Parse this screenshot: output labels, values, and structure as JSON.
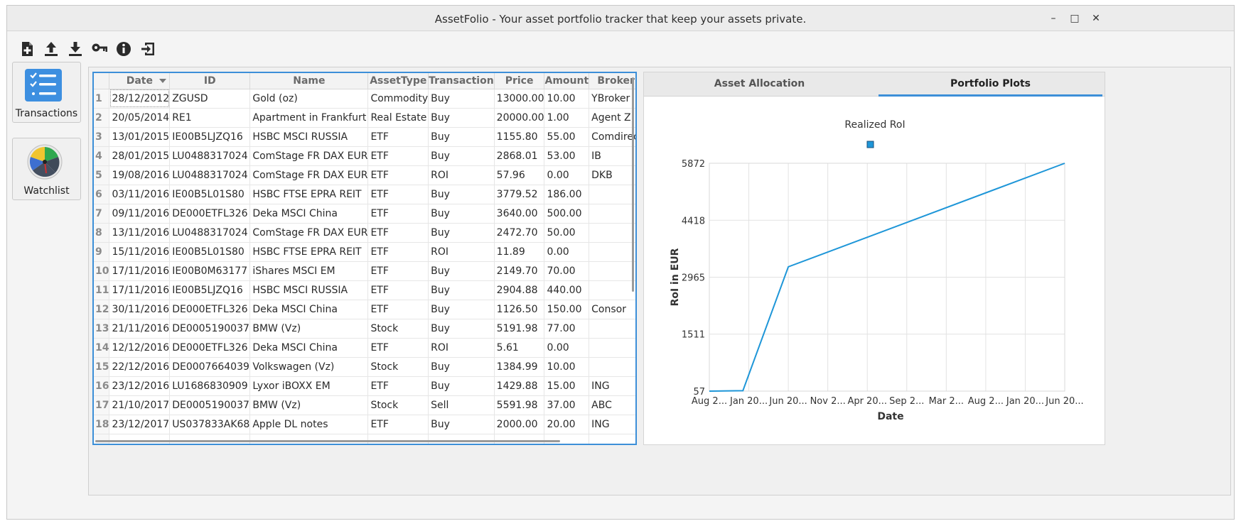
{
  "window": {
    "title": "AssetFolio - Your asset portfolio tracker that keep your assets private.",
    "controls": [
      "–",
      "□",
      "✕"
    ]
  },
  "toolbar": {
    "buttons": [
      "new-file-icon",
      "upload-icon",
      "download-icon",
      "key-icon",
      "info-icon",
      "exit-icon"
    ]
  },
  "sidebar": {
    "items": [
      {
        "label": "Transactions",
        "icon": "checklist-icon"
      },
      {
        "label": "Watchlist",
        "icon": "gauge-icon"
      }
    ]
  },
  "table": {
    "columns": [
      "Date",
      "ID",
      "Name",
      "AssetType",
      "Transaction",
      "Price",
      "Amount",
      "Broker"
    ],
    "sort_column": "Date",
    "rows": [
      [
        "28/12/2012",
        "ZGUSD",
        "Gold (oz)",
        "Commodity",
        "Buy",
        "13000.00",
        "10.00",
        "YBroker"
      ],
      [
        "20/05/2014",
        "RE1",
        "Apartment in Frankfurt",
        "Real Estate",
        "Buy",
        "20000.00",
        "1.00",
        "Agent Z"
      ],
      [
        "13/01/2015",
        "IE00B5LJZQ16",
        "HSBC MSCI RUSSIA",
        "ETF",
        "Buy",
        "1155.80",
        "55.00",
        "Comdirect"
      ],
      [
        "28/01/2015",
        "LU0488317024",
        "ComStage FR DAX EUR",
        "ETF",
        "Buy",
        "2868.01",
        "53.00",
        "IB"
      ],
      [
        "19/08/2016",
        "LU0488317024",
        "ComStage FR DAX EUR",
        "ETF",
        "ROI",
        "57.96",
        "0.00",
        "DKB"
      ],
      [
        "03/11/2016",
        "IE00B5L01S80",
        "HSBC FTSE EPRA REIT",
        "ETF",
        "Buy",
        "3779.52",
        "186.00",
        ""
      ],
      [
        "09/11/2016",
        "DE000ETFL326",
        "Deka MSCI China",
        "ETF",
        "Buy",
        "3640.00",
        "500.00",
        ""
      ],
      [
        "13/11/2016",
        "LU0488317024",
        "ComStage FR DAX EUR",
        "ETF",
        "Buy",
        "2472.70",
        "50.00",
        ""
      ],
      [
        "15/11/2016",
        "IE00B5L01S80",
        "HSBC FTSE EPRA REIT",
        "ETF",
        "ROI",
        "11.89",
        "0.00",
        ""
      ],
      [
        "17/11/2016",
        "IE00B0M63177",
        "iShares MSCI EM",
        "ETF",
        "Buy",
        "2149.70",
        "70.00",
        ""
      ],
      [
        "17/11/2016",
        "IE00B5LJZQ16",
        "HSBC MSCI RUSSIA",
        "ETF",
        "Buy",
        "2904.88",
        "440.00",
        ""
      ],
      [
        "30/11/2016",
        "DE000ETFL326",
        "Deka MSCI China",
        "ETF",
        "Buy",
        "1126.50",
        "150.00",
        "Consor"
      ],
      [
        "21/11/2016",
        "DE0005190037",
        "BMW (Vz)",
        "Stock",
        "Buy",
        "5191.98",
        "77.00",
        ""
      ],
      [
        "12/12/2016",
        "DE000ETFL326",
        "Deka MSCI China",
        "ETF",
        "ROI",
        "5.61",
        "0.00",
        ""
      ],
      [
        "22/12/2016",
        "DE0007664039",
        "Volkswagen (Vz)",
        "Stock",
        "Buy",
        "1384.99",
        "10.00",
        ""
      ],
      [
        "23/12/2016",
        "LU1686830909",
        "Lyxor iBOXX EM",
        "ETF",
        "Buy",
        "1429.88",
        "15.00",
        "ING"
      ],
      [
        "21/10/2017",
        "DE0005190037",
        "BMW (Vz)",
        "Stock",
        "Sell",
        "5591.98",
        "37.00",
        "ABC"
      ],
      [
        "23/12/2017",
        "US037833AK68",
        "Apple DL notes",
        "ETF",
        "Buy",
        "2000.00",
        "20.00",
        "ING"
      ]
    ]
  },
  "tabs": [
    {
      "label": "Asset Allocation",
      "active": false
    },
    {
      "label": "Portfolio Plots",
      "active": true
    }
  ],
  "chart_data": {
    "type": "line",
    "title": "Realized RoI",
    "xlabel": "Date",
    "ylabel": "RoI in EUR",
    "ylim": [
      57,
      5872
    ],
    "y_ticks": [
      "57",
      "1511",
      "2965",
      "4418",
      "5872"
    ],
    "x_ticks": [
      "Aug 2...",
      "Jan 20...",
      "Jun 20...",
      "Nov 2...",
      "Apr 20...",
      "Sep 2...",
      "Mar 2...",
      "Aug 2...",
      "Jan 20...",
      "Jun 20..."
    ],
    "series": [
      {
        "name": "",
        "color": "#1e96d8",
        "points": [
          {
            "x": 0,
            "y": 57
          },
          {
            "x": 0.85,
            "y": 69
          },
          {
            "x": 2.0,
            "y": 3230
          },
          {
            "x": 9.0,
            "y": 5872
          }
        ]
      }
    ],
    "legend_marker_color": "#1e96d8",
    "grid": true
  }
}
